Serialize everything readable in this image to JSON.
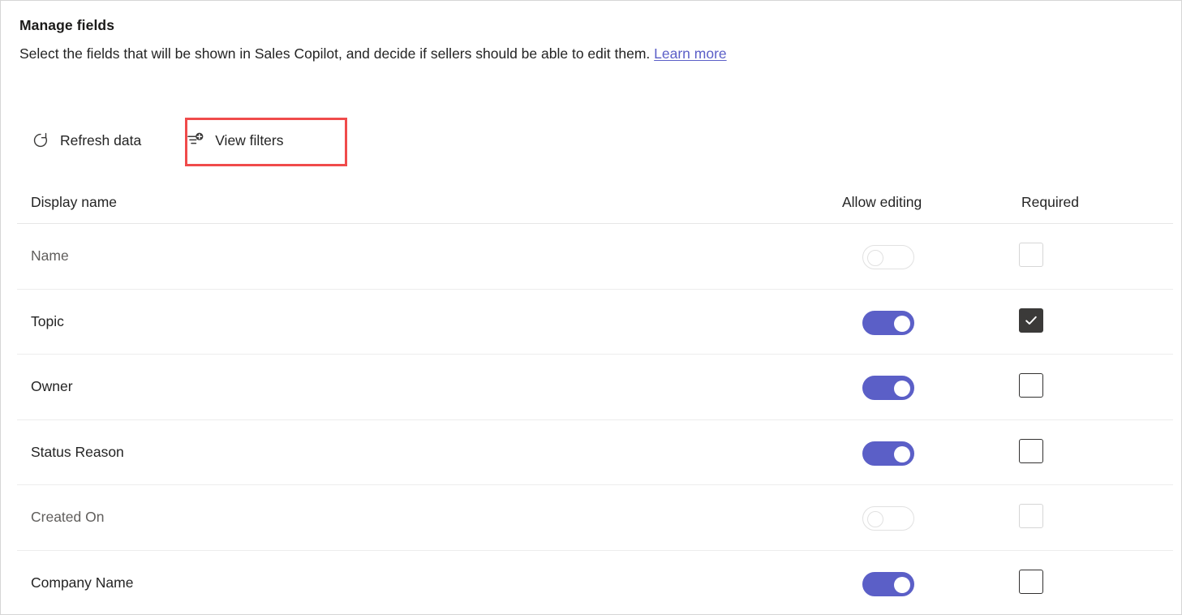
{
  "header": {
    "title": "Manage fields",
    "subtitle_text": "Select the fields that will be shown in Sales Copilot, and decide if sellers should be able to edit them.",
    "learn_more_label": "Learn more"
  },
  "toolbar": {
    "refresh_label": "Refresh data",
    "refresh_icon": "refresh-icon",
    "view_filters_label": "View filters",
    "view_filters_icon": "filter-add-icon",
    "highlight_color": "#f04b4b"
  },
  "table": {
    "columns": {
      "display_name": "Display name",
      "allow_editing": "Allow editing",
      "required": "Required"
    },
    "rows": [
      {
        "display_name": "Name",
        "allow_editing": false,
        "allow_editing_disabled": true,
        "required": false,
        "required_disabled": true
      },
      {
        "display_name": "Topic",
        "allow_editing": true,
        "allow_editing_disabled": false,
        "required": true,
        "required_disabled": false
      },
      {
        "display_name": "Owner",
        "allow_editing": true,
        "allow_editing_disabled": false,
        "required": false,
        "required_disabled": false
      },
      {
        "display_name": "Status Reason",
        "allow_editing": true,
        "allow_editing_disabled": false,
        "required": false,
        "required_disabled": false
      },
      {
        "display_name": "Created On",
        "allow_editing": false,
        "allow_editing_disabled": true,
        "required": false,
        "required_disabled": true
      },
      {
        "display_name": "Company Name",
        "allow_editing": true,
        "allow_editing_disabled": false,
        "required": false,
        "required_disabled": false
      }
    ]
  },
  "colors": {
    "toggle_on": "#5b5fc7",
    "checkbox_checked": "#3b3a39",
    "link": "#5b5fc7",
    "highlight": "#f04b4b"
  }
}
